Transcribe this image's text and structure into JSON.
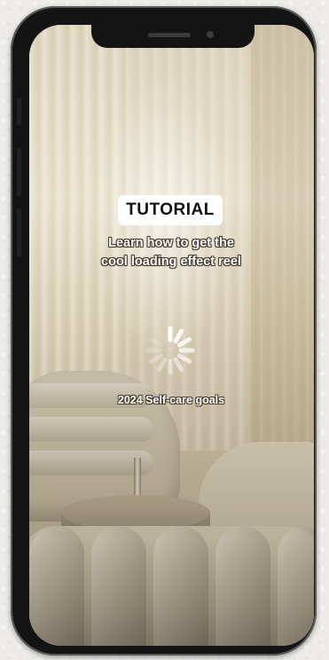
{
  "reel": {
    "badge": "TUTORIAL",
    "subtitle_line1": "Learn how to get the",
    "subtitle_line2": "cool loading effect reel",
    "caption": "2024 Self-care goals",
    "loading_icon": "loading-spinner-icon"
  },
  "device": {
    "frame_color": "#141414",
    "badge_background": "#ffffff",
    "text_color": "#ffffff"
  }
}
